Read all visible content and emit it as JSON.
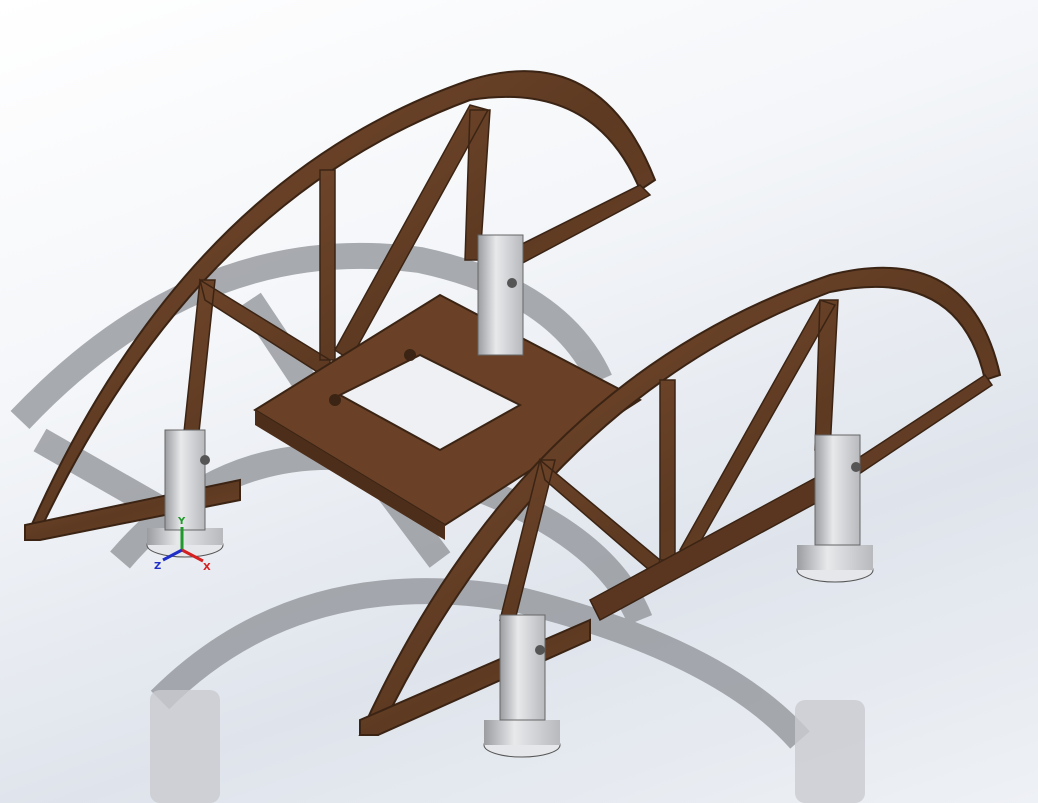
{
  "viewport": {
    "model_material_color": "#6b4329",
    "post_color": "#d7d8db",
    "shadow_color": "#8c8f94"
  },
  "triad": {
    "x_label": "X",
    "y_label": "Y",
    "z_label": "Z",
    "x_color": "#d42020",
    "y_color": "#1f9a2a",
    "z_color": "#1f2fc8"
  }
}
